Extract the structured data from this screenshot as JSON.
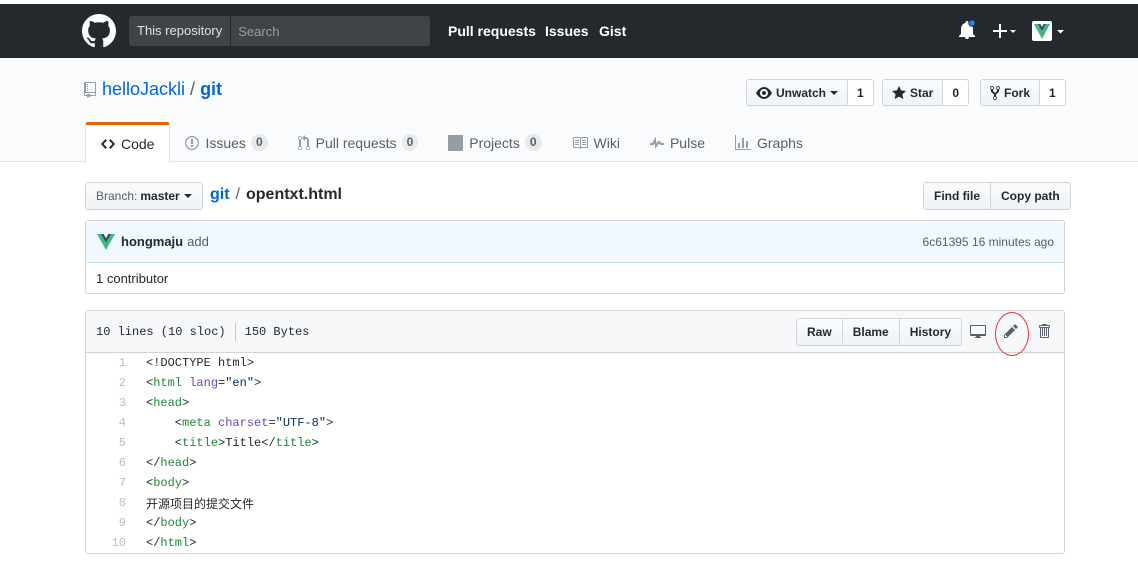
{
  "header": {
    "scope_label": "This repository",
    "search_placeholder": "Search",
    "nav": [
      "Pull requests",
      "Issues",
      "Gist"
    ]
  },
  "repo": {
    "owner": "helloJackli",
    "separator": "/",
    "name": "git",
    "watch_label": "Unwatch",
    "watch_count": "1",
    "star_label": "Star",
    "star_count": "0",
    "fork_label": "Fork",
    "fork_count": "1"
  },
  "tabs": [
    {
      "label": "Code",
      "icon": "code-icon",
      "count": null
    },
    {
      "label": "Issues",
      "icon": "issue-icon",
      "count": "0"
    },
    {
      "label": "Pull requests",
      "icon": "pull-request-icon",
      "count": "0"
    },
    {
      "label": "Projects",
      "icon": "project-icon",
      "count": "0"
    },
    {
      "label": "Wiki",
      "icon": "book-icon",
      "count": null
    },
    {
      "label": "Pulse",
      "icon": "pulse-icon",
      "count": null
    },
    {
      "label": "Graphs",
      "icon": "graph-icon",
      "count": null
    }
  ],
  "file_nav": {
    "branch_prefix": "Branch:",
    "branch": "master",
    "path_root": "git",
    "path_sep": "/",
    "file_name": "opentxt.html",
    "find_file": "Find file",
    "copy_path": "Copy path"
  },
  "commit": {
    "author": "hongmaju",
    "message": "add",
    "sha": "6c61395",
    "time": "16 minutes ago",
    "contributors": "1 contributor"
  },
  "file": {
    "lines_info": "10 lines (10 sloc)",
    "size": "150 Bytes",
    "raw": "Raw",
    "blame": "Blame",
    "history": "History",
    "code_lines": [
      "<!DOCTYPE html>",
      "<html lang=\"en\">",
      "<head>",
      "    <meta charset=\"UTF-8\">",
      "    <title>Title</title>",
      "</head>",
      "<body>",
      "开源项目的提交文件",
      "</body>",
      "</html>"
    ]
  },
  "colors": {
    "header_bg": "#24292e",
    "link": "#0366d6",
    "tab_accent": "#e36209",
    "annotation": "#e8312f"
  }
}
